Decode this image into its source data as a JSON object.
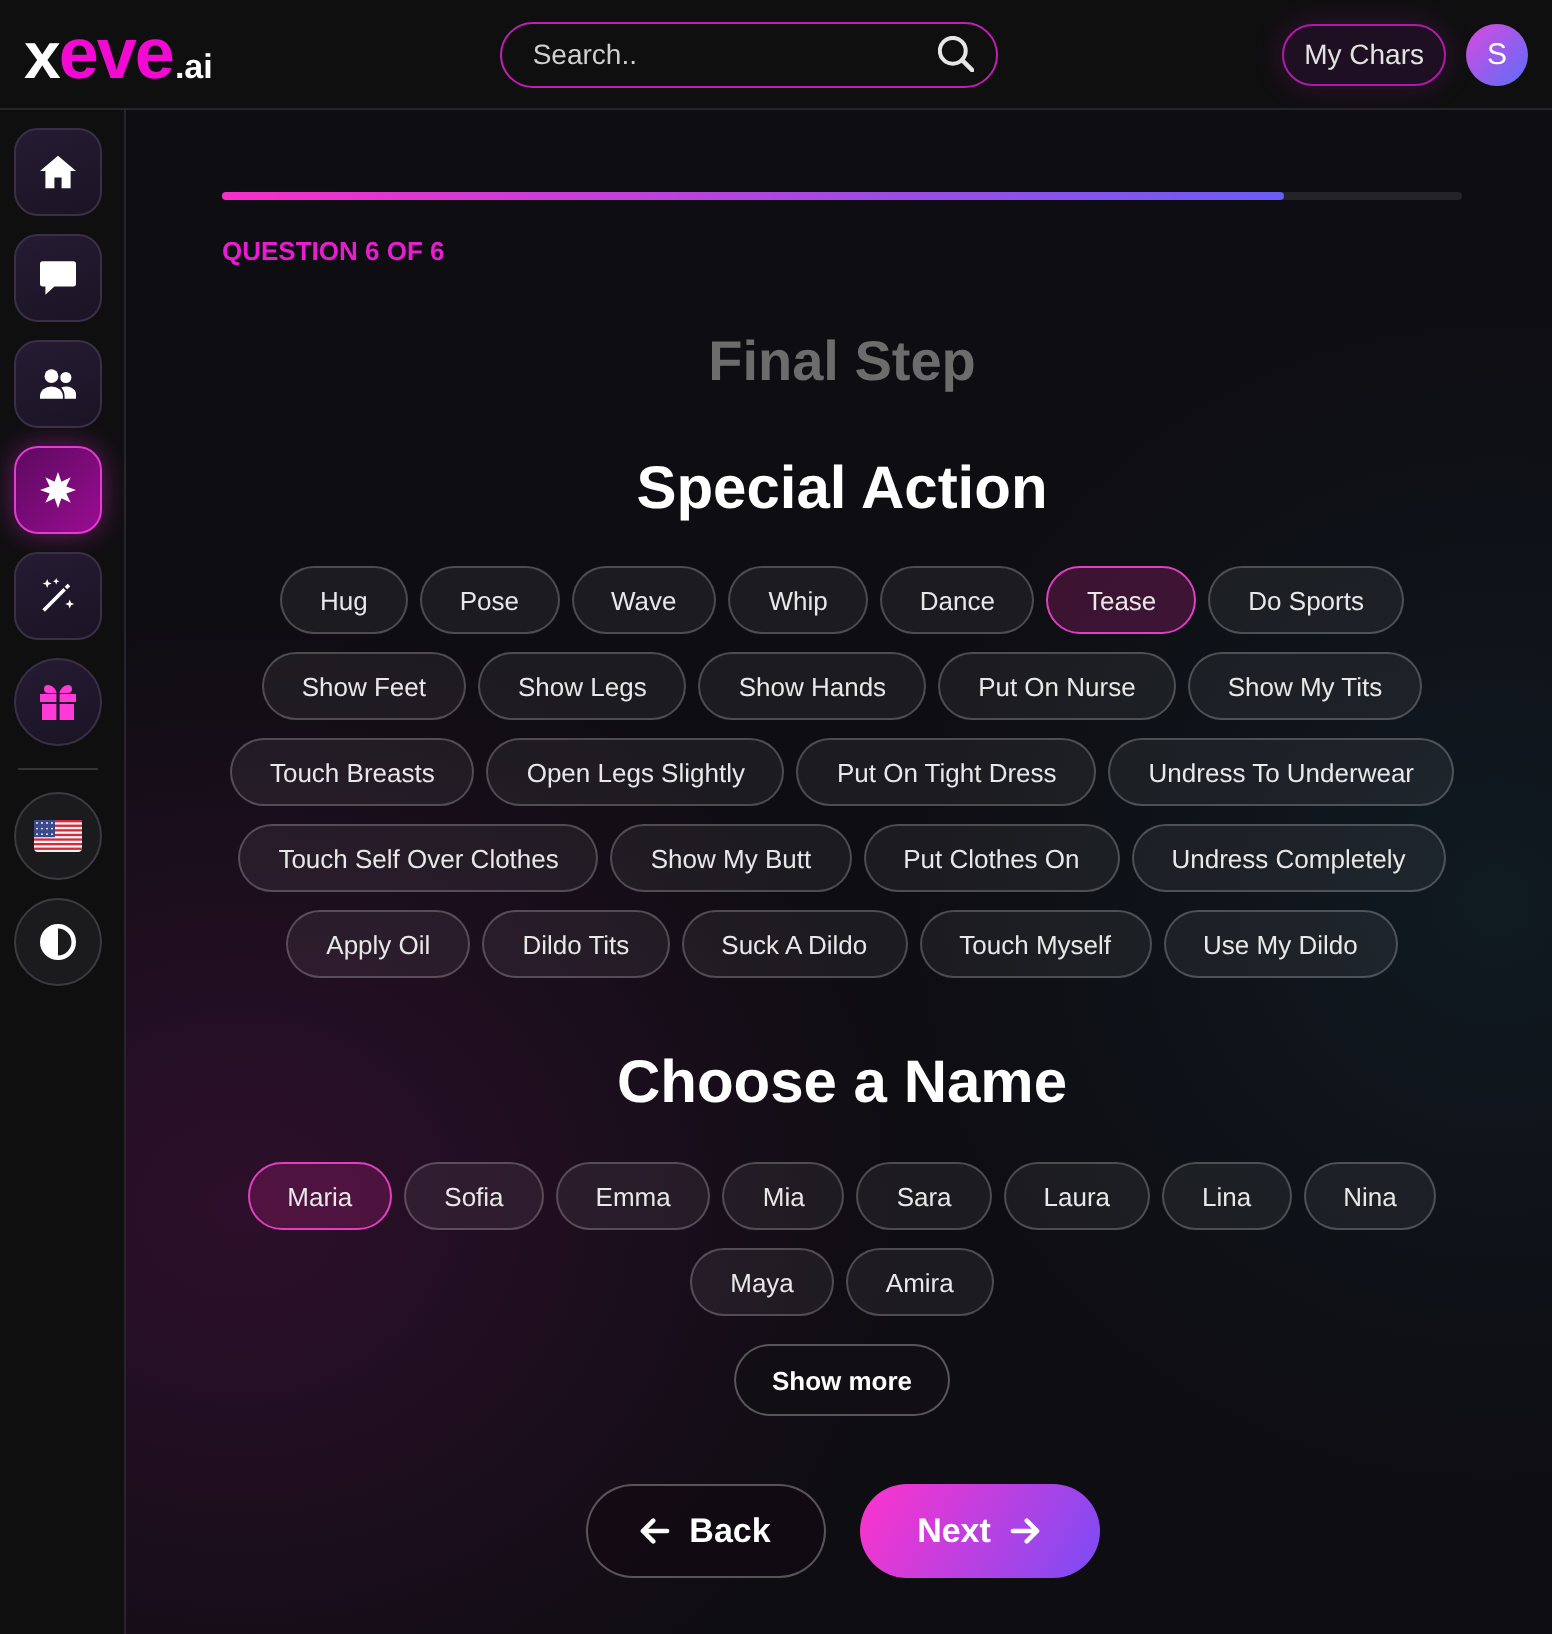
{
  "header": {
    "logo": [
      {
        "text": "x",
        "kind": "plain"
      },
      {
        "text": "eve",
        "kind": "accent"
      },
      {
        "text": ".ai",
        "kind": "suffix"
      }
    ],
    "search": {
      "placeholder": "Search.."
    },
    "my_chars": "My Chars",
    "avatar": "S"
  },
  "sidebar": {
    "items": [
      {
        "kind": "page",
        "selected": false
      },
      {
        "kind": "page",
        "selected": false
      },
      {
        "kind": "page",
        "selected": false
      },
      {
        "kind": "page",
        "selected": true
      },
      {
        "kind": "page",
        "selected": false
      },
      {
        "kind": "offer",
        "selected": false
      }
    ]
  },
  "progress": {
    "level": 0.857,
    "label": "QUESTION 6 OF 6"
  },
  "step_title": "Final Step",
  "special_action": {
    "title": "Special Action",
    "options": [
      {
        "label": "Hug",
        "selected": false
      },
      {
        "label": "Pose",
        "selected": false
      },
      {
        "label": "Wave",
        "selected": false
      },
      {
        "label": "Whip",
        "selected": false
      },
      {
        "label": "Dance",
        "selected": false
      },
      {
        "label": "Tease",
        "selected": true
      },
      {
        "label": "Do Sports",
        "selected": false
      },
      {
        "label": "Show Feet",
        "selected": false
      },
      {
        "label": "Show Legs",
        "selected": false
      },
      {
        "label": "Show Hands",
        "selected": false
      },
      {
        "label": "Put On Nurse",
        "selected": false
      },
      {
        "label": "Show My Tits",
        "selected": false
      },
      {
        "label": "Touch Breasts",
        "selected": false
      },
      {
        "label": "Open Legs Slightly",
        "selected": false
      },
      {
        "label": "Put On Tight Dress",
        "selected": false
      },
      {
        "label": "Undress To Underwear",
        "selected": false
      },
      {
        "label": "Touch Self Over Clothes",
        "selected": false
      },
      {
        "label": "Show My Butt",
        "selected": false
      },
      {
        "label": "Put Clothes On",
        "selected": false
      },
      {
        "label": "Undress Completely",
        "selected": false
      },
      {
        "label": "Apply Oil",
        "selected": false
      },
      {
        "label": "Dildo Tits",
        "selected": false
      },
      {
        "label": "Suck A Dildo",
        "selected": false
      },
      {
        "label": "Touch Myself",
        "selected": false
      },
      {
        "label": "Use My Dildo",
        "selected": false
      }
    ]
  },
  "choose_name": {
    "title": "Choose a Name",
    "options": [
      {
        "label": "Maria",
        "selected": true
      },
      {
        "label": "Sofia",
        "selected": false
      },
      {
        "label": "Emma",
        "selected": false
      },
      {
        "label": "Mia",
        "selected": false
      },
      {
        "label": "Sara",
        "selected": false
      },
      {
        "label": "Laura",
        "selected": false
      },
      {
        "label": "Lina",
        "selected": false
      },
      {
        "label": "Nina",
        "selected": false
      },
      {
        "label": "Maya",
        "selected": false
      },
      {
        "label": "Amira",
        "selected": false
      }
    ],
    "show_more": "Show more"
  },
  "nav": {
    "back": "Back",
    "next": "Next"
  }
}
